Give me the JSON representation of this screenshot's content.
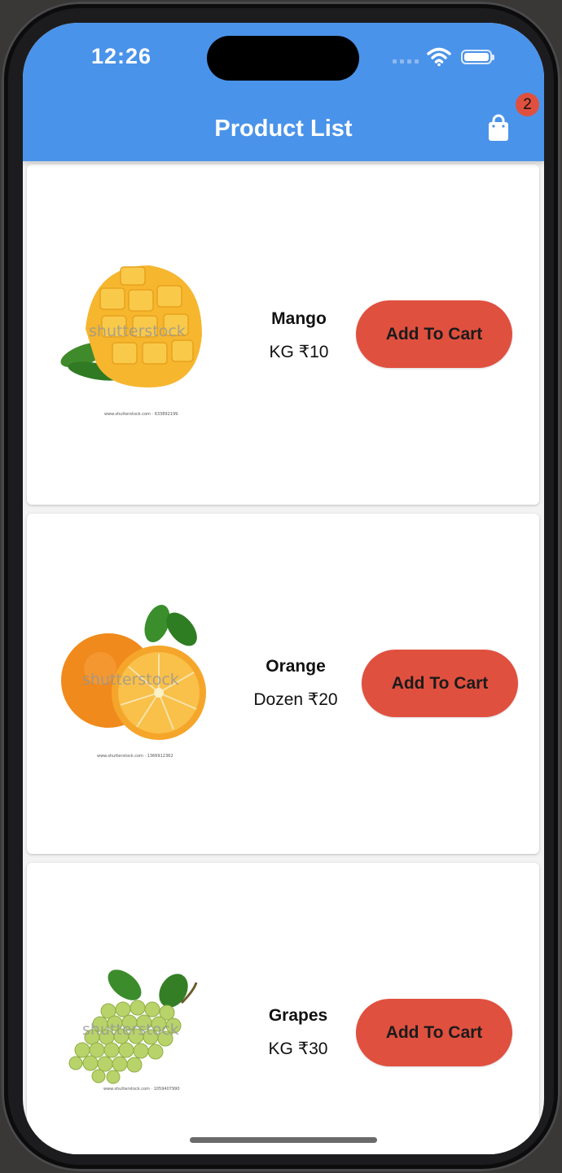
{
  "status_bar": {
    "time": "12:26"
  },
  "app_bar": {
    "title": "Product List",
    "cart_count": "2",
    "cart_icon": "shopping-bag-icon"
  },
  "products": [
    {
      "name": "Mango",
      "price": "KG ₹10",
      "button_label": "Add To Cart",
      "watermark": "shutterstock",
      "caption": "www.shutterstock.com · 633892199"
    },
    {
      "name": "Orange",
      "price": "Dozen ₹20",
      "button_label": "Add To Cart",
      "watermark": "shutterstock",
      "caption": "www.shutterstock.com · 1366912362"
    },
    {
      "name": "Grapes",
      "price": "KG ₹30",
      "button_label": "Add To Cart",
      "watermark": "shutterstock",
      "caption": "www.shutterstock.com · 1059407990"
    }
  ],
  "colors": {
    "app_bar": "#4a93ea",
    "button": "#e0503f",
    "badge": "#e0503f"
  }
}
